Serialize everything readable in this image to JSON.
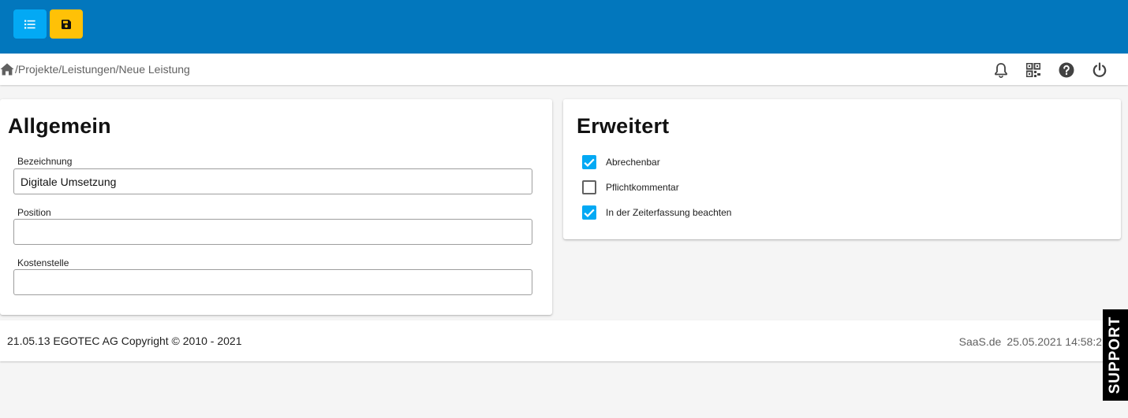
{
  "toolbar": {
    "list_icon": "list-icon",
    "save_icon": "floppy-disk-icon",
    "list_color": "#03a9f4",
    "save_color": "#ffc107",
    "bar_color": "#0277bd"
  },
  "breadcrumb": {
    "home_icon": "home-icon",
    "path": "/Projekte/Leistungen/Neue Leistung"
  },
  "nav_icons": [
    "bell-icon",
    "qr-code-icon",
    "help-icon",
    "power-icon"
  ],
  "general": {
    "title": "Allgemein",
    "fields": [
      {
        "label": "Bezeichnung",
        "value": "Digitale Umsetzung"
      },
      {
        "label": "Position",
        "value": ""
      },
      {
        "label": "Kostenstelle",
        "value": ""
      }
    ]
  },
  "extended": {
    "title": "Erweitert",
    "checkboxes": [
      {
        "label": "Abrechenbar",
        "checked": true
      },
      {
        "label": "Pflichtkommentar",
        "checked": false
      },
      {
        "label": "In der Zeiterfassung beachten",
        "checked": true
      }
    ]
  },
  "footer": {
    "left": "21.05.13 EGOTEC AG Copyright © 2010 - 2021",
    "site": "SaaS.de",
    "datetime": "25.05.2021 14:58:2"
  },
  "support": {
    "label": "SUPPORT"
  }
}
